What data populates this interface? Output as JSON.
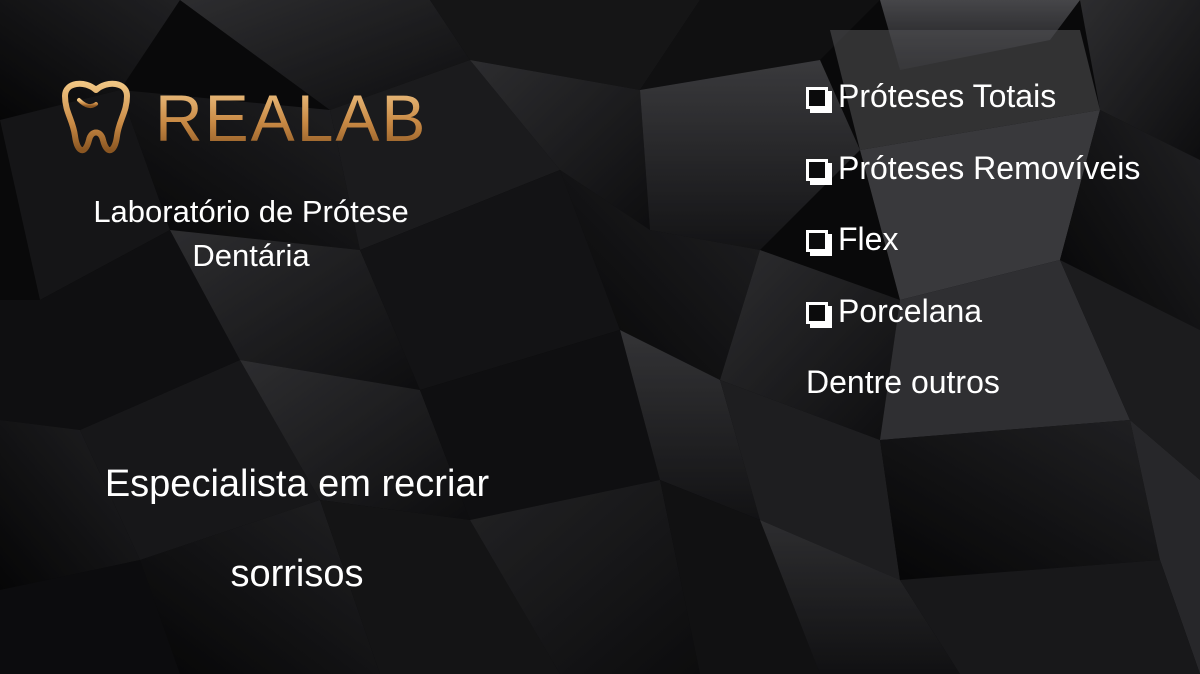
{
  "brand": {
    "name": "REALAB",
    "tagline": "Laboratório de Prótese Dentária",
    "logo_icon": "tooth-icon",
    "gold": "#d49a55"
  },
  "slogan": {
    "line1": "Especialista em recriar",
    "line2": "sorrisos"
  },
  "services": [
    {
      "label": "Próteses Totais",
      "icon": "checkbox-icon"
    },
    {
      "label": "Próteses Removíveis",
      "icon": "checkbox-icon"
    },
    {
      "label": "Flex",
      "icon": "checkbox-icon"
    },
    {
      "label": "Porcelana",
      "icon": "checkbox-icon"
    }
  ],
  "others_label": "Dentre outros",
  "background": {
    "style": "dark faceted geometric cubes",
    "color": "#0b0b0c"
  }
}
